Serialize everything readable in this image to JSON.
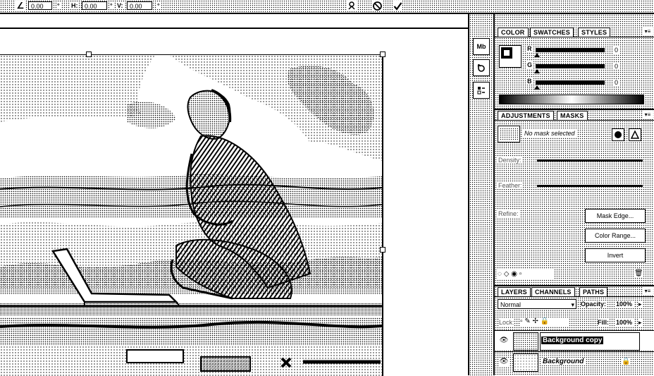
{
  "options_bar": {
    "angle_icon": "angle-icon",
    "angle_value": "0.00",
    "angle_unit": "°",
    "h_label": "H:",
    "h_value": "0.00",
    "h_unit": "°",
    "v_label": "V:",
    "v_value": "0.00",
    "v_unit": "°",
    "warp_icon": "warp-icon",
    "cancel_icon": "cancel-icon",
    "commit_icon": "commit-icon"
  },
  "dock": {
    "mini_bridge_label": "Mb",
    "history_icon": "history-icon",
    "actions_icon": "actions-icon"
  },
  "color_panel": {
    "tabs": [
      "COLOR",
      "SWATCHES",
      "STYLES"
    ],
    "channels": [
      {
        "label": "R",
        "value": "0"
      },
      {
        "label": "G",
        "value": "0"
      },
      {
        "label": "B",
        "value": "0"
      }
    ]
  },
  "masks_panel": {
    "tabs": [
      "ADJUSTMENTS",
      "MASKS"
    ],
    "status": "No mask selected",
    "density_label": "Density:",
    "feather_label": "Feather:",
    "refine_label": "Refine:",
    "buttons": [
      "Mask Edge...",
      "Color Range...",
      "Invert"
    ]
  },
  "layers_panel": {
    "tabs": [
      "LAYERS",
      "CHANNELS",
      "PATHS"
    ],
    "blend_mode": "Normal",
    "opacity_label": "Opacity:",
    "opacity_value": "100%",
    "lock_label": "Lock:",
    "fill_label": "Fill:",
    "fill_value": "100%",
    "layers": [
      {
        "name": "Background copy",
        "locked": false
      },
      {
        "name": "Background",
        "locked": true
      }
    ]
  }
}
